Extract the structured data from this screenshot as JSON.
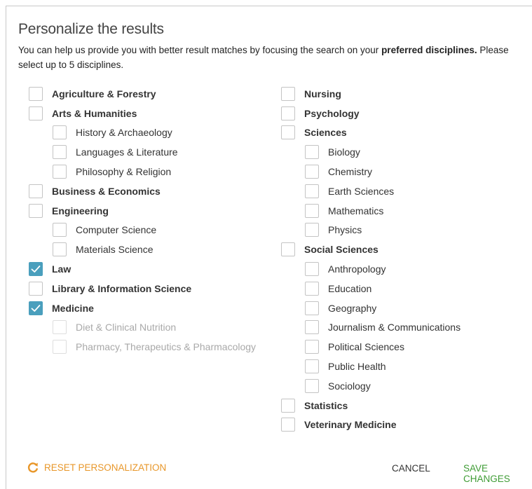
{
  "dialog": {
    "title": "Personalize the results",
    "desc_pre": "You can help us provide you with better result matches by focusing the search on your ",
    "desc_bold": "preferred disciplines.",
    "desc_post": " Please select up to 5 disciplines."
  },
  "colors": {
    "accent": "#4a9fbd",
    "reset": "#e8972a",
    "save": "#3f9c35"
  },
  "left_column": [
    {
      "label": "Agriculture & Forestry",
      "level": "top",
      "checked": false,
      "disabled": false
    },
    {
      "label": "Arts & Humanities",
      "level": "top",
      "checked": false,
      "disabled": false
    },
    {
      "label": "History & Archaeology",
      "level": "sub",
      "checked": false,
      "disabled": false
    },
    {
      "label": "Languages & Literature",
      "level": "sub",
      "checked": false,
      "disabled": false
    },
    {
      "label": "Philosophy & Religion",
      "level": "sub",
      "checked": false,
      "disabled": false
    },
    {
      "label": "Business & Economics",
      "level": "top",
      "checked": false,
      "disabled": false
    },
    {
      "label": "Engineering",
      "level": "top",
      "checked": false,
      "disabled": false
    },
    {
      "label": "Computer Science",
      "level": "sub",
      "checked": false,
      "disabled": false
    },
    {
      "label": "Materials Science",
      "level": "sub",
      "checked": false,
      "disabled": false
    },
    {
      "label": "Law",
      "level": "top",
      "checked": true,
      "disabled": false
    },
    {
      "label": "Library & Information Science",
      "level": "top",
      "checked": false,
      "disabled": false
    },
    {
      "label": "Medicine",
      "level": "top",
      "checked": true,
      "disabled": false
    },
    {
      "label": "Diet & Clinical Nutrition",
      "level": "sub",
      "checked": false,
      "disabled": true
    },
    {
      "label": "Pharmacy, Therapeutics & Pharmacology",
      "level": "sub",
      "checked": false,
      "disabled": true
    }
  ],
  "right_column": [
    {
      "label": "Nursing",
      "level": "top",
      "checked": false,
      "disabled": false
    },
    {
      "label": "Psychology",
      "level": "top",
      "checked": false,
      "disabled": false
    },
    {
      "label": "Sciences",
      "level": "top",
      "checked": false,
      "disabled": false
    },
    {
      "label": "Biology",
      "level": "sub",
      "checked": false,
      "disabled": false
    },
    {
      "label": "Chemistry",
      "level": "sub",
      "checked": false,
      "disabled": false
    },
    {
      "label": "Earth Sciences",
      "level": "sub",
      "checked": false,
      "disabled": false
    },
    {
      "label": "Mathematics",
      "level": "sub",
      "checked": false,
      "disabled": false
    },
    {
      "label": "Physics",
      "level": "sub",
      "checked": false,
      "disabled": false
    },
    {
      "label": "Social Sciences",
      "level": "top",
      "checked": false,
      "disabled": false
    },
    {
      "label": "Anthropology",
      "level": "sub",
      "checked": false,
      "disabled": false
    },
    {
      "label": "Education",
      "level": "sub",
      "checked": false,
      "disabled": false
    },
    {
      "label": "Geography",
      "level": "sub",
      "checked": false,
      "disabled": false
    },
    {
      "label": "Journalism & Communications",
      "level": "sub",
      "checked": false,
      "disabled": false
    },
    {
      "label": "Political Sciences",
      "level": "sub",
      "checked": false,
      "disabled": false
    },
    {
      "label": "Public Health",
      "level": "sub",
      "checked": false,
      "disabled": false
    },
    {
      "label": "Sociology",
      "level": "sub",
      "checked": false,
      "disabled": false
    },
    {
      "label": "Statistics",
      "level": "top",
      "checked": false,
      "disabled": false
    },
    {
      "label": "Veterinary Medicine",
      "level": "top",
      "checked": false,
      "disabled": false
    }
  ],
  "footer": {
    "reset_label": "RESET PERSONALIZATION",
    "reset_icon": "refresh-icon",
    "cancel_label": "CANCEL",
    "save_label": "SAVE CHANGES"
  }
}
